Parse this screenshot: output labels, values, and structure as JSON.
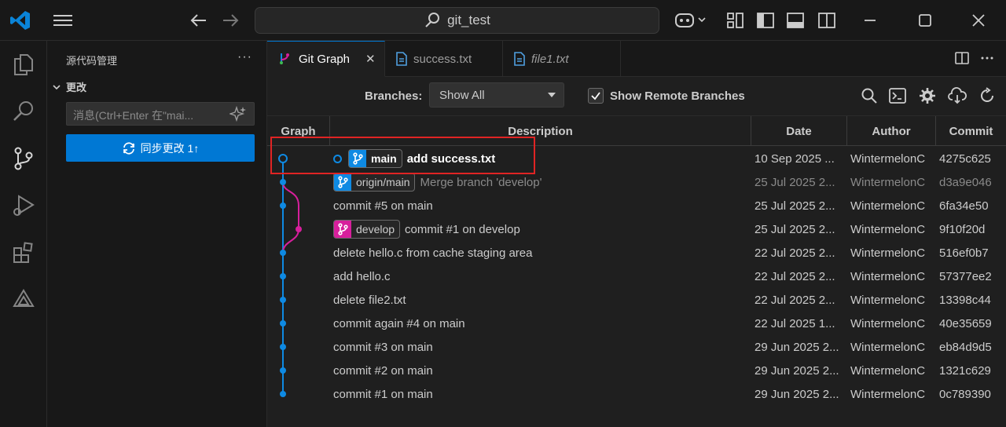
{
  "titlebar": {
    "search_text": "git_test",
    "colors": {
      "accent": "#0078d4"
    }
  },
  "sidebar": {
    "title": "源代码管理",
    "more": "···",
    "section_label": "更改",
    "message_placeholder": "消息(Ctrl+Enter 在\"mai...",
    "sync_label": "同步更改 1↑"
  },
  "tabs": [
    {
      "label": "Git Graph",
      "active": true,
      "close": "✕"
    },
    {
      "label": "success.txt",
      "active": false
    },
    {
      "label": "file1.txt",
      "active": false
    }
  ],
  "toolbar": {
    "branches_label": "Branches:",
    "branches_value": "Show All",
    "remote_label": "Show Remote Branches",
    "remote_checked": true
  },
  "table": {
    "headers": [
      "Graph",
      "Description",
      "Date",
      "Author",
      "Commit"
    ],
    "rows": [
      {
        "refs": [
          {
            "name": "main",
            "head": true,
            "color": "#0e8ae3"
          }
        ],
        "message": "add success.txt",
        "date": "10 Sep 2025 ...",
        "author": "WintermelonC",
        "commit": "4275c625",
        "dim": false,
        "head": true
      },
      {
        "refs": [
          {
            "name": "origin/main",
            "head": false,
            "color": "#0e8ae3"
          }
        ],
        "message": "Merge branch 'develop'",
        "date": "25 Jul 2025 2...",
        "author": "WintermelonC",
        "commit": "d3a9e046",
        "dim": true
      },
      {
        "refs": [],
        "message": "commit #5 on main",
        "date": "25 Jul 2025 2...",
        "author": "WintermelonC",
        "commit": "6fa34e50"
      },
      {
        "refs": [
          {
            "name": "develop",
            "head": false,
            "color": "#d71f9c"
          }
        ],
        "message": "commit #1 on develop",
        "date": "25 Jul 2025 2...",
        "author": "WintermelonC",
        "commit": "9f10f20d"
      },
      {
        "refs": [],
        "message": "delete hello.c from cache staging area",
        "date": "22 Jul 2025 2...",
        "author": "WintermelonC",
        "commit": "516ef0b7"
      },
      {
        "refs": [],
        "message": "add hello.c",
        "date": "22 Jul 2025 2...",
        "author": "WintermelonC",
        "commit": "57377ee2"
      },
      {
        "refs": [],
        "message": "delete file2.txt",
        "date": "22 Jul 2025 2...",
        "author": "WintermelonC",
        "commit": "13398c44"
      },
      {
        "refs": [],
        "message": "commit again #4 on main",
        "date": "22 Jul 2025 1...",
        "author": "WintermelonC",
        "commit": "40e35659"
      },
      {
        "refs": [],
        "message": "commit #3 on main",
        "date": "29 Jun 2025 2...",
        "author": "WintermelonC",
        "commit": "eb84d9d5"
      },
      {
        "refs": [],
        "message": "commit #2 on main",
        "date": "29 Jun 2025 2...",
        "author": "WintermelonC",
        "commit": "1321c629"
      },
      {
        "refs": [],
        "message": "commit #1 on main",
        "date": "29 Jun 2025 2...",
        "author": "WintermelonC",
        "commit": "0c789390"
      }
    ]
  },
  "graph_colors": {
    "main": "#0e8ae3",
    "develop": "#d71f9c"
  }
}
